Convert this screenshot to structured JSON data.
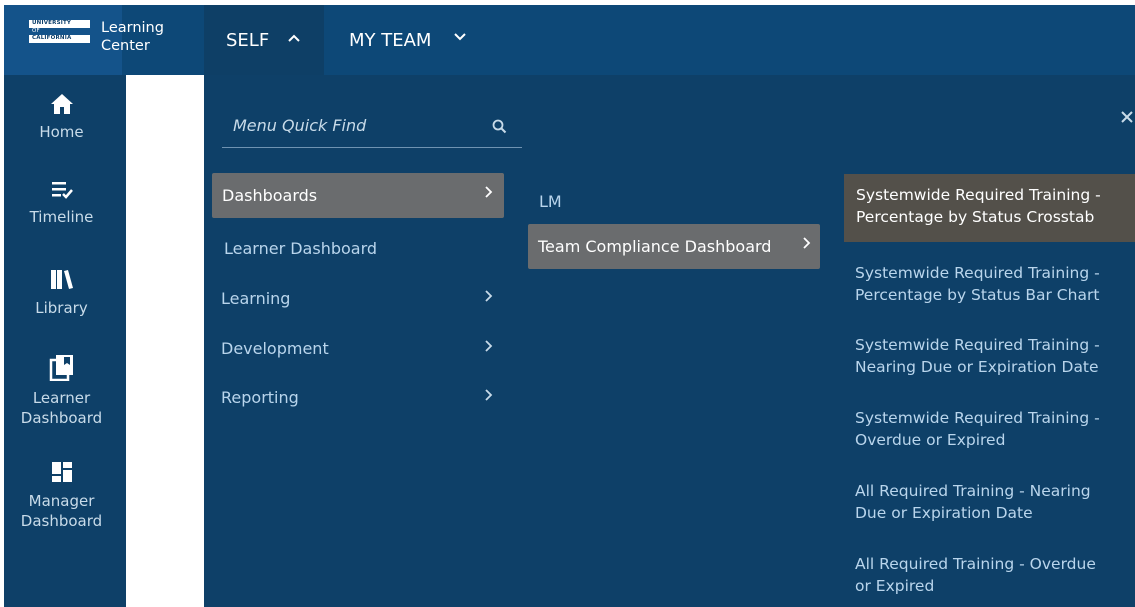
{
  "logo": {
    "line1": "UNIVERSITY",
    "line2": "OF",
    "line3": "CALIFORNIA",
    "product_line1": "Learning",
    "product_line2": "Center"
  },
  "top_nav": [
    {
      "label": "SELF",
      "chevron": "chevron-up-icon",
      "active": true
    },
    {
      "label": "MY TEAM",
      "chevron": "chevron-down-icon",
      "active": false
    }
  ],
  "side_nav": [
    {
      "label": "Home",
      "icon": "home-icon"
    },
    {
      "label": "Timeline",
      "icon": "timeline-icon"
    },
    {
      "label": "Library",
      "icon": "library-icon"
    },
    {
      "label": "Learner Dashboard",
      "label_line1": "Learner",
      "label_line2": "Dashboard",
      "icon": "learner-dashboard-icon"
    },
    {
      "label": "Manager Dashboard",
      "label_line1": "Manager",
      "label_line2": "Dashboard",
      "icon": "manager-dashboard-icon"
    }
  ],
  "search": {
    "placeholder": "Menu Quick Find",
    "value": ""
  },
  "menu_level1": [
    {
      "label": "Dashboards",
      "has_submenu": true,
      "selected": true
    },
    {
      "label": "Learner Dashboard",
      "has_submenu": false
    },
    {
      "label": "Learning",
      "has_submenu": true
    },
    {
      "label": "Development",
      "has_submenu": true
    },
    {
      "label": "Reporting",
      "has_submenu": true
    }
  ],
  "menu_level2": [
    {
      "label": "LM",
      "has_submenu": false
    },
    {
      "label": "Team Compliance Dashboard",
      "has_submenu": true,
      "selected": true
    }
  ],
  "menu_level3": [
    {
      "label": "Systemwide Required Training - Percentage by Status Crosstab",
      "line1": "Systemwide Required Training -",
      "line2": "Percentage by Status Crosstab",
      "selected": true
    },
    {
      "label": "Systemwide Required Training - Percentage by Status Bar Chart",
      "line1": "Systemwide Required Training -",
      "line2": "Percentage by Status Bar Chart"
    },
    {
      "label": "Systemwide Required Training - Nearing Due or Expiration Date",
      "line1": "Systemwide Required Training -",
      "line2": "Nearing Due or Expiration Date"
    },
    {
      "label": "Systemwide Required Training - Overdue or Expired",
      "line1": "Systemwide Required Training -",
      "line2": "Overdue or Expired"
    },
    {
      "label": "All Required Training - Nearing Due or Expiration Date",
      "line1": "All Required Training - Nearing",
      "line2": "Due or Expiration Date"
    },
    {
      "label": "All Required Training - Overdue or Expired",
      "line1": "All Required Training - Overdue",
      "line2": "or Expired"
    }
  ],
  "colors": {
    "header": "#0d4877",
    "panel": "#0e4068",
    "selected_item": "#6a6c6e",
    "selected_report": "#53504a",
    "link_text": "#b9d5ec"
  }
}
